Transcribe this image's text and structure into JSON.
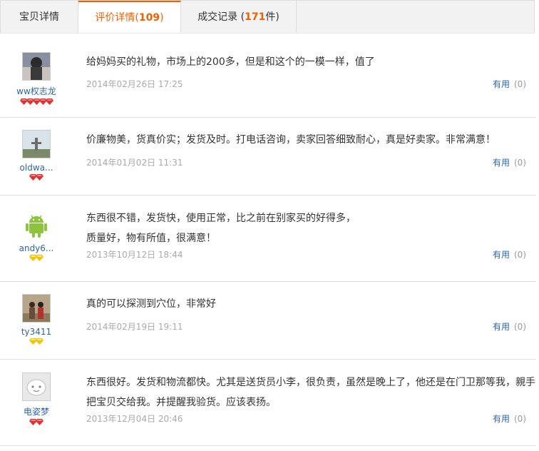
{
  "tabs": [
    {
      "label": "宝贝详情"
    },
    {
      "label": "评价详情(",
      "count": "109",
      "suffix": ")"
    },
    {
      "label": "成交记录 (",
      "count": "171",
      "suffix": "件)"
    }
  ],
  "reviews": [
    {
      "user": "ww权志龙",
      "avatar": "photo-avatar",
      "level": "red-diamond",
      "level_count": 5,
      "lines": [
        "给妈妈买的礼物，市场上的200多，但是和这个的一模一样，值了"
      ],
      "date": "2014年02月26日 17:25",
      "useful_label": "有用",
      "useful_count": "(0)"
    },
    {
      "user": "oldwa...",
      "avatar": "landscape-avatar",
      "level": "red-diamond",
      "level_count": 2,
      "lines": [
        "价廉物美，货真价实；发货及时。打电话咨询，卖家回答细致耐心，真是好卖家。非常满意！"
      ],
      "date": "2014年01月02日 11:31",
      "useful_label": "有用",
      "useful_count": "(0)"
    },
    {
      "user": "andy6...",
      "avatar": "android-icon",
      "level": "yellow-diamond",
      "level_count": 2,
      "lines": [
        "东西很不错，发货快，使用正常，比之前在别家买的好得多，",
        "质量好，物有所值，很满意！"
      ],
      "date": "2013年10月12日 18:44",
      "useful_label": "有用",
      "useful_count": "(0)"
    },
    {
      "user": "ty3411",
      "avatar": "couple-photo-avatar",
      "level": "yellow-diamond",
      "level_count": 2,
      "lines": [
        "真的可以探测到穴位，非常好"
      ],
      "date": "2014年02月19日 19:11",
      "useful_label": "有用",
      "useful_count": "(0)"
    },
    {
      "user": "电姿梦",
      "avatar": "default-face-avatar",
      "level": "red-diamond",
      "level_count": 2,
      "lines": [
        "东西很好。发货和物流都快。尤其是送货员小李，很负责，虽然是晚上了，他还是在门卫那等我，親手",
        "把宝贝交给我。并提醒我验货。应该表扬。"
      ],
      "date": "2013年12月04日 20:46",
      "useful_label": "有用",
      "useful_count": "(0)"
    }
  ],
  "colors": {
    "accent": "#f06000",
    "link": "#2e65a5",
    "red_diamond": "#e0312f",
    "yellow_diamond": "#f5c200"
  }
}
